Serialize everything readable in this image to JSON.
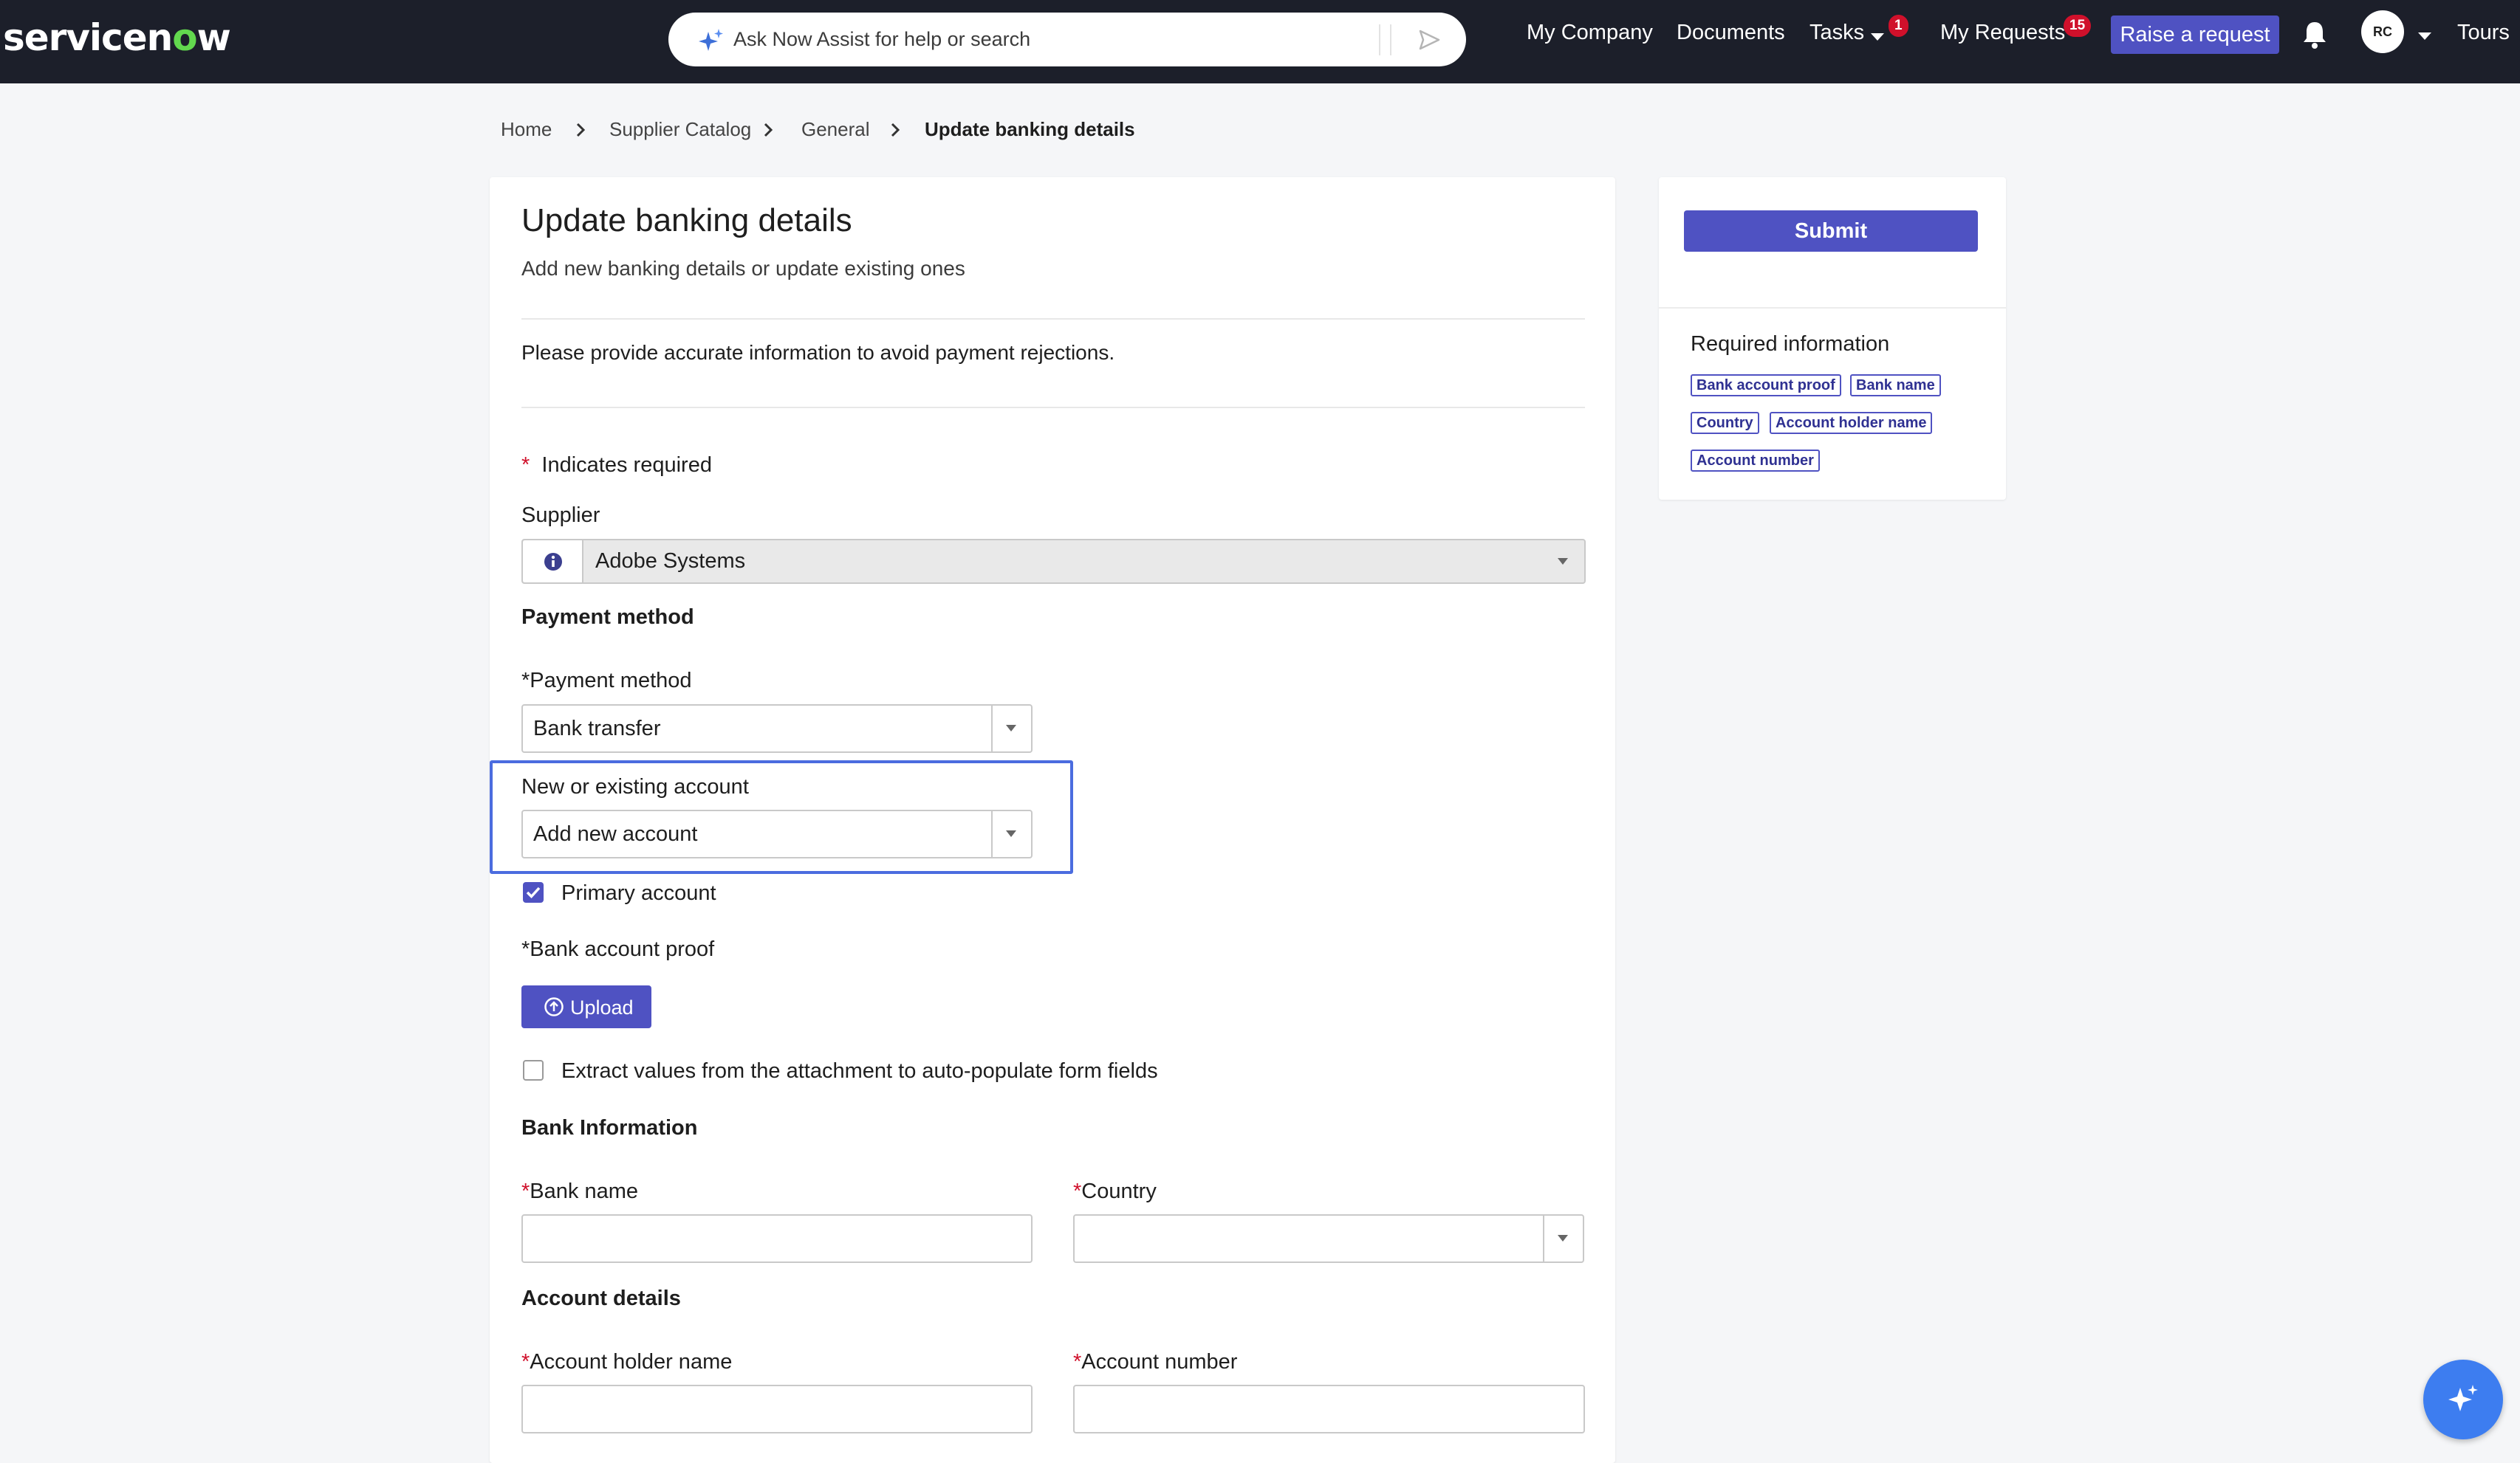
{
  "nav": {
    "logo_prefix": "servicen",
    "logo_o": "o",
    "logo_suffix": "w",
    "search_placeholder": "Ask Now Assist for help or search",
    "links": {
      "my_company": "My Company",
      "documents": "Documents",
      "tasks": "Tasks",
      "tasks_badge": "1",
      "my_requests": "My Requests",
      "my_requests_badge": "15",
      "tours": "Tours"
    },
    "raise_request": "Raise a request",
    "avatar_initials": "RC"
  },
  "breadcrumb": {
    "items": [
      "Home",
      "Supplier Catalog",
      "General"
    ],
    "current": "Update banking details"
  },
  "form": {
    "title": "Update banking details",
    "subtitle": "Add new banking details or update existing ones",
    "notice": "Please provide accurate information to avoid payment rejections.",
    "required_marker": "*",
    "indicates_required": "Indicates required",
    "supplier_label": "Supplier",
    "supplier_value": "Adobe Systems",
    "payment_section": "Payment method",
    "payment_method_label": "Payment method",
    "payment_method_value": "Bank transfer",
    "account_label": "New or existing account",
    "account_value": "Add new account",
    "primary_account_label": "Primary account",
    "primary_account_checked": true,
    "bank_proof_label": "Bank account proof",
    "upload_label": "Upload",
    "extract_label": "Extract values from the attachment to auto-populate form fields",
    "extract_checked": false,
    "bank_section": "Bank Information",
    "bank_name_label": "Bank name",
    "bank_name_value": "",
    "country_label": "Country",
    "country_value": "",
    "account_section": "Account details",
    "holder_label": "Account holder name",
    "holder_value": "",
    "number_label": "Account number",
    "number_value": ""
  },
  "sidebar": {
    "submit": "Submit",
    "required_title": "Required information",
    "chips": [
      "Bank account proof",
      "Bank name",
      "Country",
      "Account holder name",
      "Account number"
    ]
  },
  "colors": {
    "nav_bg": "#1c1f2a",
    "primary": "#4f52c2",
    "highlight": "#4b6cdf",
    "required": "#d0102b",
    "logo_accent": "#62d84e",
    "fab": "#3d7df0"
  },
  "icons": [
    "sparkle-icon",
    "send-icon",
    "chevron-down-icon",
    "bell-icon",
    "chevron-right-icon",
    "info-icon",
    "upload-icon",
    "check-icon"
  ]
}
